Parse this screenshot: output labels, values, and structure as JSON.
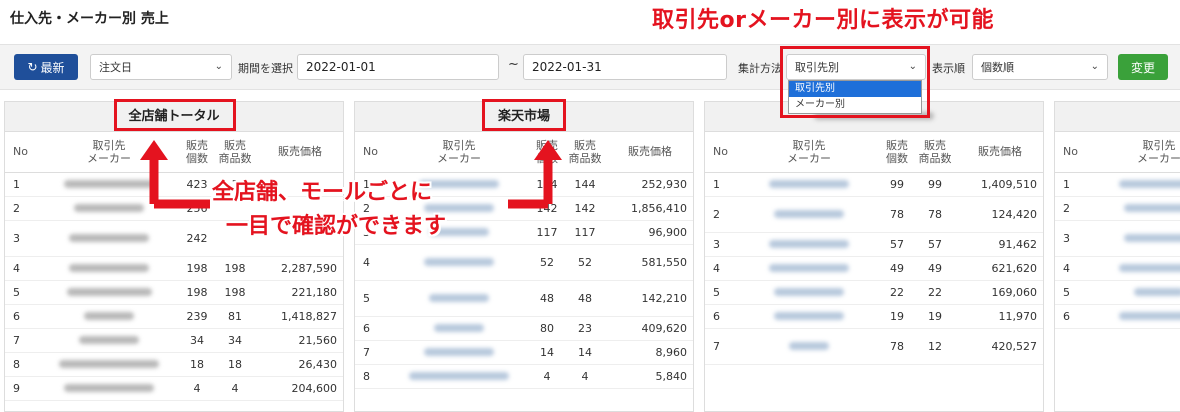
{
  "page": {
    "title": "仕入先・メーカー別 売上",
    "headline": "取引先orメーカー別に表示が可能"
  },
  "toolbar": {
    "refresh_label": "最新",
    "order_select": "注文日",
    "period_label": "期間を選択",
    "date_from": "2022-01-01",
    "tilde": "~",
    "date_to": "2022-01-31",
    "agg_label": "集計方法",
    "agg_select": "取引先別",
    "sort_label": "表示順",
    "sort_select": "個数順",
    "change_label": "変更"
  },
  "dropdown": {
    "options": [
      "取引先別",
      "メーカー別"
    ]
  },
  "callouts": {
    "line1": "全店舗、モールごとに",
    "line2": "一目で確認ができます"
  },
  "columns": {
    "no": "No",
    "partner1": "取引先",
    "partner2": "メーカー",
    "qty1": "販売",
    "qty2": "個数",
    "items1": "販売",
    "items2": "商品数",
    "price": "販売価格"
  },
  "panels": [
    {
      "title": "全店舗トータル",
      "rows": [
        {
          "no": "1",
          "qty": "423",
          "items": "1",
          "price": ""
        },
        {
          "no": "2",
          "qty": "256",
          "items": "",
          "price": ""
        },
        {
          "no": "3",
          "qty": "242",
          "items": "",
          "price": ""
        },
        {
          "no": "4",
          "qty": "198",
          "items": "198",
          "price": "2,287,590"
        },
        {
          "no": "5",
          "qty": "198",
          "items": "198",
          "price": "221,180"
        },
        {
          "no": "6",
          "qty": "239",
          "items": "81",
          "price": "1,418,827"
        },
        {
          "no": "7",
          "qty": "34",
          "items": "34",
          "price": "21,560"
        },
        {
          "no": "8",
          "qty": "18",
          "items": "18",
          "price": "26,430"
        },
        {
          "no": "9",
          "qty": "4",
          "items": "4",
          "price": "204,600"
        }
      ]
    },
    {
      "title": "楽天市場",
      "rows": [
        {
          "no": "1",
          "qty": "144",
          "items": "144",
          "price": "252,930"
        },
        {
          "no": "2",
          "qty": "142",
          "items": "142",
          "price": "1,856,410"
        },
        {
          "no": "3",
          "qty": "117",
          "items": "117",
          "price": "96,900"
        },
        {
          "no": "4",
          "qty": "52",
          "items": "52",
          "price": "581,550"
        },
        {
          "no": "5",
          "qty": "48",
          "items": "48",
          "price": "142,210"
        },
        {
          "no": "6",
          "qty": "80",
          "items": "23",
          "price": "409,620"
        },
        {
          "no": "7",
          "qty": "14",
          "items": "14",
          "price": "8,960"
        },
        {
          "no": "8",
          "qty": "4",
          "items": "4",
          "price": "5,840"
        }
      ]
    },
    {
      "title": "",
      "rows": [
        {
          "no": "1",
          "qty": "99",
          "items": "99",
          "price": "1,409,510"
        },
        {
          "no": "2",
          "qty": "78",
          "items": "78",
          "price": "124,420"
        },
        {
          "no": "3",
          "qty": "57",
          "items": "57",
          "price": "91,462"
        },
        {
          "no": "4",
          "qty": "49",
          "items": "49",
          "price": "621,620"
        },
        {
          "no": "5",
          "qty": "22",
          "items": "22",
          "price": "169,060"
        },
        {
          "no": "6",
          "qty": "19",
          "items": "19",
          "price": "11,970"
        },
        {
          "no": "7",
          "qty": "78",
          "items": "12",
          "price": "420,527"
        }
      ]
    },
    {
      "title": "",
      "rows": [
        {
          "no": "1"
        },
        {
          "no": "2"
        },
        {
          "no": "3"
        },
        {
          "no": "4"
        },
        {
          "no": "5"
        },
        {
          "no": "6"
        }
      ]
    }
  ],
  "colors": {
    "accent_red": "#e4131f",
    "refresh_blue": "#1f4f9a",
    "change_green": "#3aa13a",
    "dropdown_active": "#1e6fd9"
  }
}
